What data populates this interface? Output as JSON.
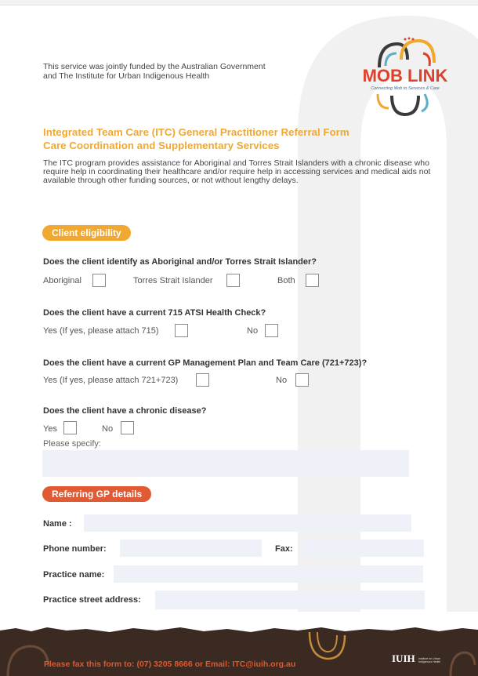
{
  "intro_text": "This service was jointly funded by the Australian Government and The Institute for Urban Indigenous Health",
  "logo": {
    "name": "MOB LINK",
    "tagline": "Connecting Mob to Services & Care"
  },
  "title_line1": "Integrated Team Care (ITC) General Practitioner Referral Form",
  "title_line2": "Care Coordination and Supplementary Services",
  "description": "The ITC program provides assistance for Aboriginal and Torres Strait Islanders with a chronic disease who require help in coordinating their healthcare and/or require help in accessing services and medical aids not available through other funding sources, or not without lengthy delays.",
  "eligibility": {
    "heading": "Client eligibility",
    "q1": {
      "question": "Does the client identify as Aboriginal and/or Torres Strait Islander?",
      "opt1": "Aboriginal",
      "opt2": "Torres Strait Islander",
      "opt3": "Both"
    },
    "q2": {
      "question": "Does the client have a current 715 ATSI Health Check?",
      "yes": "Yes (If yes, please attach 715)",
      "no": "No"
    },
    "q3": {
      "question": "Does the client have a current GP Management Plan and Team Care (721+723)?",
      "yes": "Yes (If yes, please attach 721+723)",
      "no": "No"
    },
    "q4": {
      "question": "Does the client have a chronic disease?",
      "yes": "Yes",
      "no": "No",
      "specify": "Please specify:"
    }
  },
  "gp": {
    "heading": "Referring GP details",
    "name_label": "Name :",
    "phone_label": "Phone number:",
    "fax_label": "Fax:",
    "practice_label": "Practice name:",
    "address_label": "Practice street address:"
  },
  "footer": {
    "text": "Please fax this form to: (07) 3205 8666 or Email: ITC@iuih.org.au",
    "logo": "IUIH",
    "logo_sub": "Institute for Urban Indigenous Health"
  },
  "colors": {
    "accent_orange": "#f0a830",
    "accent_red": "#e05a34",
    "footer_bg": "#3b2a22",
    "field_bg": "#eef1f8"
  }
}
